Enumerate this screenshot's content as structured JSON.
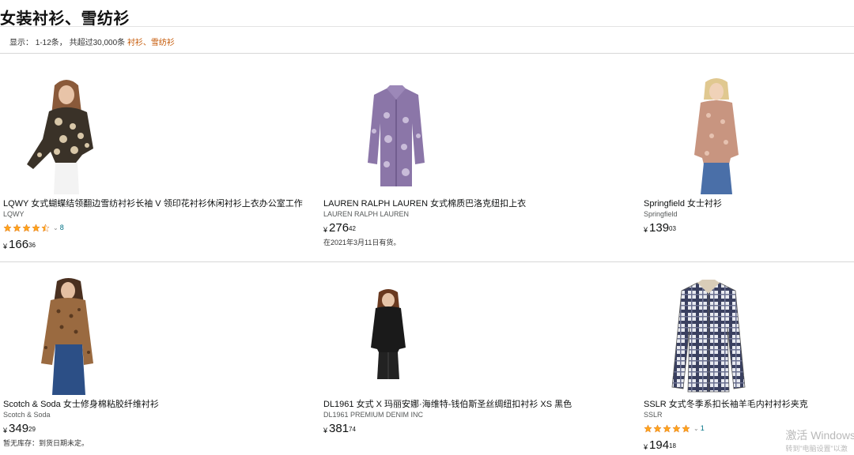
{
  "page": {
    "title": "女装衬衫、雪纺衫",
    "result_prefix": "显示： 1-12条， 共超过30,000条 ",
    "result_keywords": "衬衫、雪纺衫"
  },
  "products": [
    {
      "title": "LQWY 女式蝴蝶结领翻边雪纺衬衫长袖 V 领印花衬衫休闲衬衫上衣办公室工作",
      "brand": "LQWY",
      "rating": 4.5,
      "rating_count": "8",
      "price_symbol": "¥",
      "price_whole": "166",
      "price_fraction": "36",
      "note": "",
      "image_icon": "model-floral-blouse-image"
    },
    {
      "title": "LAUREN RALPH LAUREN 女式棉质巴洛克纽扣上衣",
      "brand": "LAUREN RALPH LAUREN",
      "price_symbol": "¥",
      "price_whole": "276",
      "price_fraction": "42",
      "note": "在2021年3月11日有货。",
      "image_icon": "purple-paisley-shirt-image"
    },
    {
      "title": "Springfield 女士衬衫",
      "brand": "Springfield",
      "price_symbol": "¥",
      "price_whole": "139",
      "price_fraction": "03",
      "note": "",
      "image_icon": "model-floral-shirt-image"
    },
    {
      "title": "Scotch & Soda 女士修身棉粘胶纤维衬衫",
      "brand": "Scotch & Soda",
      "price_symbol": "¥",
      "price_whole": "349",
      "price_fraction": "29",
      "note": "暂无库存：到货日期未定。",
      "image_icon": "model-leopard-shirt-image"
    },
    {
      "title": "DL1961 女式 X 玛丽安娜·海维特-钱伯斯圣丝绸纽扣衬衫 XS 黑色",
      "brand": "DL1961 PREMIUM DENIM INC",
      "price_symbol": "¥",
      "price_whole": "381",
      "price_fraction": "74",
      "note": "",
      "image_icon": "model-black-silk-shirt-image"
    },
    {
      "title": "SSLR 女式冬季系扣长袖羊毛内衬衬衫夹克",
      "brand": "SSLR",
      "rating": 5,
      "rating_count": "1",
      "price_symbol": "¥",
      "price_whole": "194",
      "price_fraction": "18",
      "note": "",
      "image_icon": "plaid-flannel-shirt-image"
    }
  ],
  "watermark": {
    "line1": "激活 Windows",
    "line2": "转到\"电脑设置\"以激"
  },
  "colors": {
    "star": "#ffa41c",
    "link": "#007185",
    "keyword": "#c45500"
  }
}
